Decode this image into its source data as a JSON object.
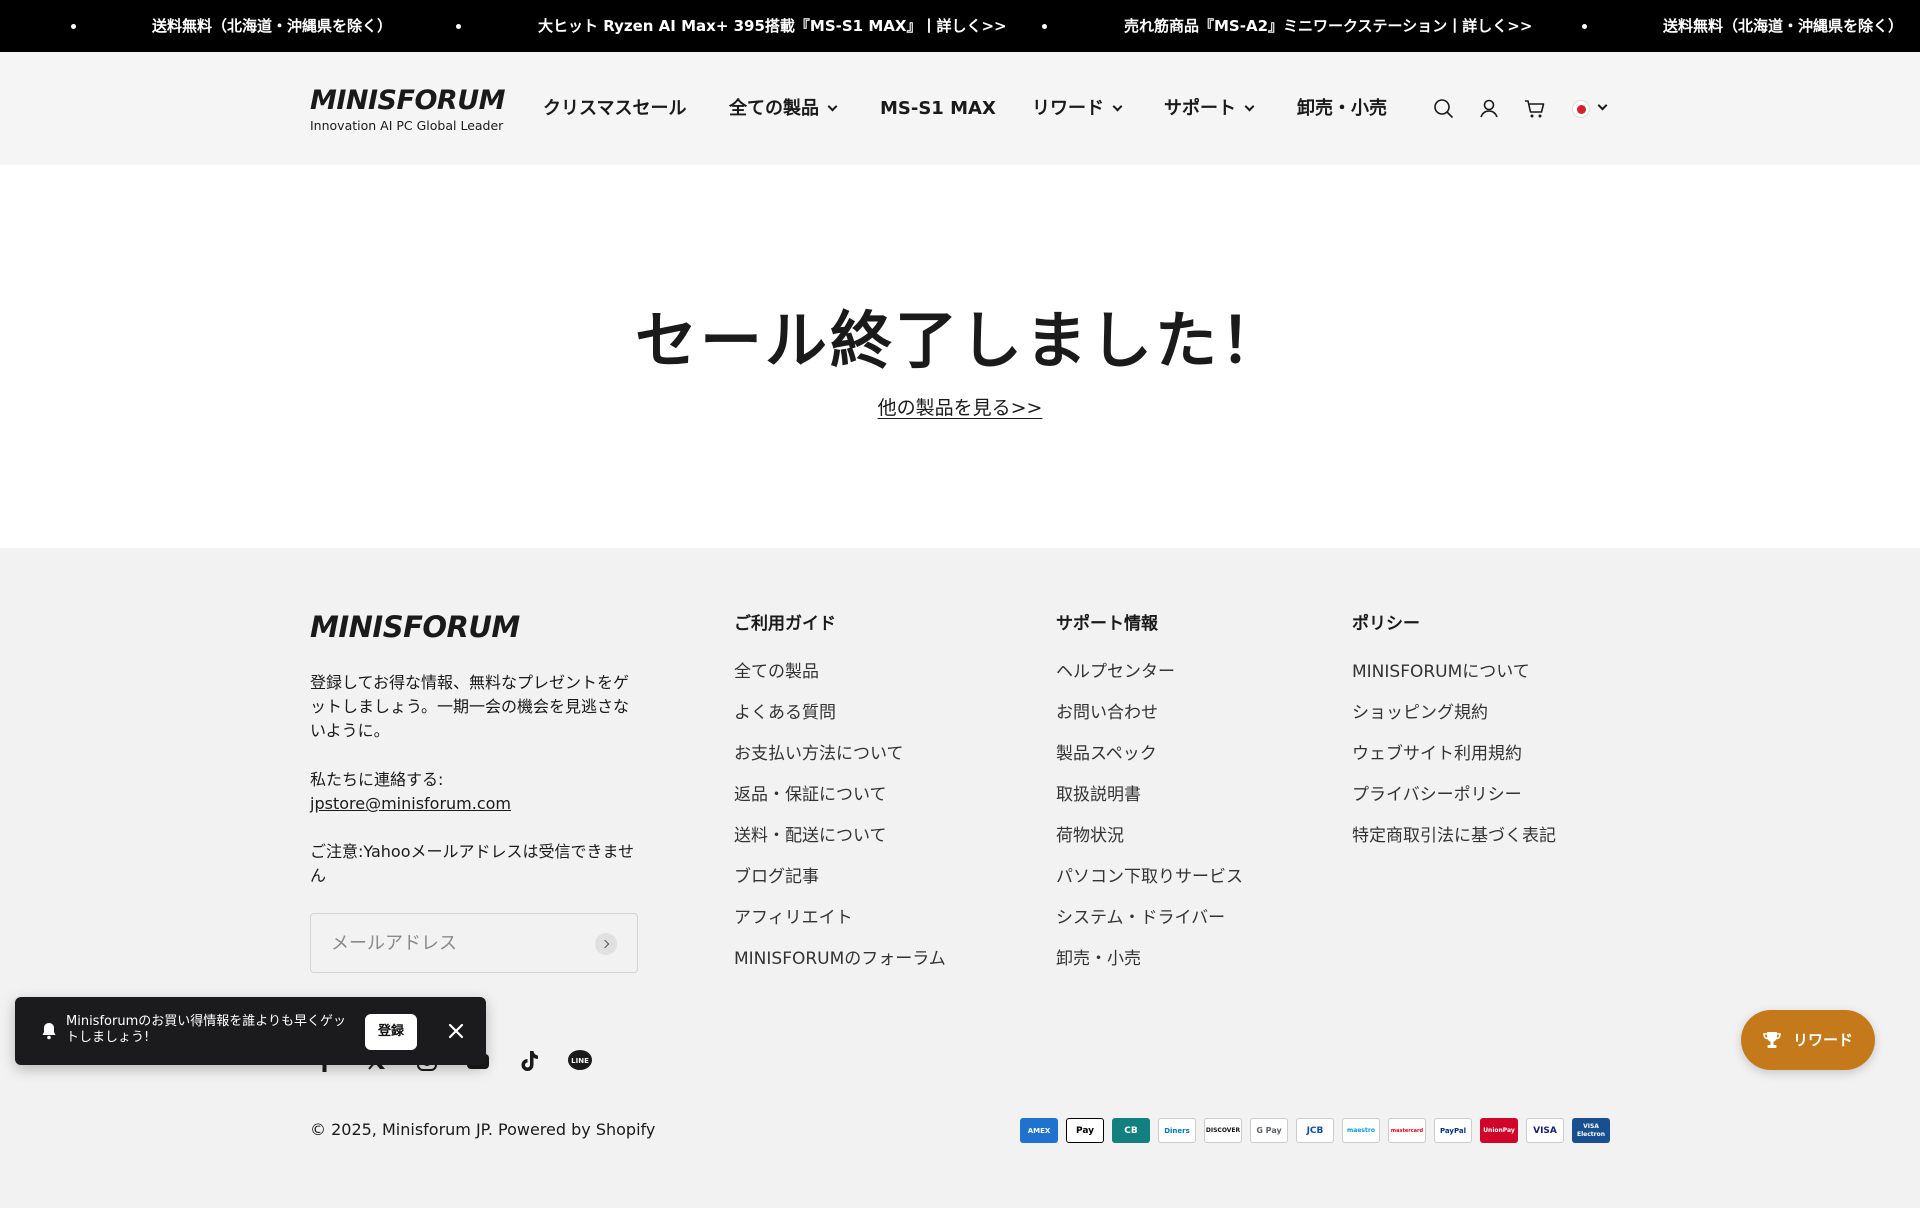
{
  "announcement": {
    "items": [
      "送料無料（北海道・沖縄県を除く）",
      "大ヒット  Ryzen AI Max+ 395搭載『MS-S1 MAX』丨詳しく>>",
      "売れ筋商品『MS-A2』ミニワークステーション丨詳しく>>",
      "送料無料（北海道・沖縄県を除く）"
    ]
  },
  "header": {
    "logo_text": "MINISFORUM",
    "logo_tagline": "Innovation AI PC Global Leader",
    "nav": [
      "クリスマスセール",
      "全ての製品",
      "MS-S1 MAX",
      "リワード",
      "サポート",
      "卸売・小売"
    ],
    "icons": [
      "search-icon",
      "account-icon",
      "cart-icon",
      "japan-flag-icon"
    ]
  },
  "main": {
    "headline": "セール終了しました！",
    "link": "他の製品を見る>>"
  },
  "footer": {
    "logo_text": "MINISFORUM",
    "signup_text": "登録してお得な情報、無料なプレゼントをゲットしましょう。一期一会の機会を見逃さないように。",
    "contact_label": "私たちに連絡する:",
    "contact_email": "jpstore@minisforum.com",
    "notice": "ご注意:Yahooメールアドレスは受信できません",
    "email_placeholder": "メールアドレス",
    "guide": {
      "title": "ご利用ガイド",
      "links": [
        "全ての製品",
        "よくある質問",
        "お支払い方法について",
        "返品・保証について",
        "送料・配送について",
        "ブログ記事",
        "アフィリエイト",
        "MINISFORUMのフォーラム"
      ]
    },
    "support": {
      "title": "サポート情報",
      "links": [
        "ヘルプセンター",
        "お問い合わせ",
        "製品スペック",
        "取扱説明書",
        "荷物状況",
        "パソコン下取りサービス",
        "システム・ドライバー",
        "卸売・小売"
      ]
    },
    "policy": {
      "title": "ポリシー",
      "links": [
        "MINISFORUMについて",
        "ショッピング規約",
        "ウェブサイト利用規約",
        "プライバシーポリシー",
        "特定商取引法に基づく表記"
      ]
    },
    "socials": [
      "facebook-icon",
      "twitter-icon",
      "instagram-icon",
      "youtube-icon",
      "tiktok-icon",
      "line-icon"
    ],
    "copyright": "© 2025, Minisforum JP. Powered by Shopify",
    "payments": [
      "AMEX",
      "Pay",
      "CB",
      "Diners",
      "DISCOVER",
      "G Pay",
      "JCB",
      "maestro",
      "mastercard",
      "PayPal",
      "UnionPay",
      "VISA",
      "VISA Electron"
    ]
  },
  "popup": {
    "message": "Minisforumのお買い得情報を誰よりも早くゲットしましょう!",
    "button": "登録"
  },
  "rewards": {
    "label": "リワード"
  },
  "colors": {
    "announcement_bg": "#000000",
    "header_bg": "#f5f5f5",
    "footer_bg": "#f2f2f2",
    "rewards_bg": "#c47a1a",
    "popup_bg": "#1b1b1d"
  }
}
